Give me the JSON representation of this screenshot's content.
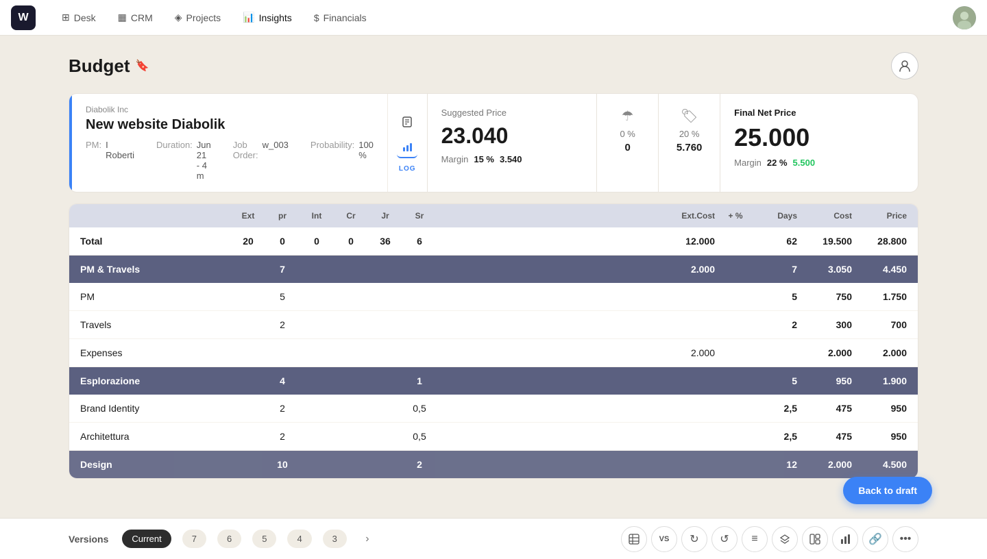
{
  "nav": {
    "logo": "W",
    "items": [
      {
        "label": "Desk",
        "icon": "grid"
      },
      {
        "label": "CRM",
        "icon": "crm"
      },
      {
        "label": "Projects",
        "icon": "layers"
      },
      {
        "label": "Insights",
        "icon": "chart",
        "active": true
      },
      {
        "label": "Financials",
        "icon": "dollar"
      }
    ]
  },
  "page": {
    "title": "Budget",
    "person_icon": "👤"
  },
  "project": {
    "company": "Diabolik Inc",
    "name": "New website Diabolik",
    "pm_label": "PM:",
    "pm_value": "I Roberti",
    "job_label": "Job Order:",
    "job_value": "w_003",
    "duration_label": "Duration:",
    "duration_value": "Jun 21 - 4 m",
    "probability_label": "Probability:",
    "probability_value": "100 %"
  },
  "pricing": {
    "suggested": {
      "title": "Suggested Price",
      "value": "23.040",
      "margin_label": "Margin",
      "margin_pct": "15 %",
      "margin_val": "3.540"
    },
    "disc1": {
      "pct": "0 %",
      "val": "0"
    },
    "disc2": {
      "pct": "20 %",
      "val": "5.760"
    },
    "final": {
      "title": "Final Net Price",
      "value": "25.000",
      "margin_label": "Margin",
      "margin_pct": "22 %",
      "margin_val": "5.500"
    }
  },
  "table": {
    "headers": [
      "",
      "Ext",
      "pr",
      "Int",
      "Cr",
      "Jr",
      "Sr",
      "Ext.Cost",
      "+ %",
      "Days",
      "Cost",
      "Price"
    ],
    "total": {
      "label": "Total",
      "ext": "20",
      "pr": "0",
      "int": "0",
      "cr": "0",
      "jr": "36",
      "sr": "6",
      "ext_cost": "12.000",
      "plus_pct": "",
      "days": "62",
      "cost": "19.500",
      "price": "28.800"
    },
    "groups": [
      {
        "label": "PM & Travels",
        "ext": "",
        "pr": "7",
        "int": "",
        "cr": "",
        "jr": "",
        "sr": "",
        "ext_cost": "2.000",
        "plus_pct": "",
        "days": "7",
        "cost": "3.050",
        "price": "4.450",
        "rows": [
          {
            "label": "PM",
            "ext": "",
            "pr": "5",
            "int": "",
            "cr": "",
            "jr": "",
            "sr": "",
            "ext_cost": "",
            "plus_pct": "",
            "days": "5",
            "cost": "750",
            "price": "1.750"
          },
          {
            "label": "Travels",
            "ext": "",
            "pr": "2",
            "int": "",
            "cr": "",
            "jr": "",
            "sr": "",
            "ext_cost": "",
            "plus_pct": "",
            "days": "2",
            "cost": "300",
            "price": "700"
          },
          {
            "label": "Expenses",
            "ext": "",
            "pr": "",
            "int": "",
            "cr": "",
            "jr": "",
            "sr": "",
            "ext_cost": "2.000",
            "plus_pct": "",
            "days": "",
            "cost": "2.000",
            "price": "2.000"
          }
        ]
      },
      {
        "label": "Esplorazione",
        "ext": "",
        "pr": "4",
        "int": "",
        "cr": "",
        "jr": "",
        "sr": "1",
        "ext_cost": "",
        "plus_pct": "",
        "days": "5",
        "cost": "950",
        "price": "1.900",
        "rows": [
          {
            "label": "Brand Identity",
            "ext": "",
            "pr": "2",
            "int": "",
            "cr": "",
            "jr": "",
            "sr": "0,5",
            "ext_cost": "",
            "plus_pct": "",
            "days": "2,5",
            "cost": "475",
            "price": "950"
          },
          {
            "label": "Architettura",
            "ext": "",
            "pr": "2",
            "int": "",
            "cr": "",
            "jr": "",
            "sr": "0,5",
            "ext_cost": "",
            "plus_pct": "",
            "days": "2,5",
            "cost": "475",
            "price": "950"
          }
        ]
      },
      {
        "label": "Design",
        "ext": "",
        "pr": "10",
        "int": "",
        "cr": "",
        "jr": "",
        "sr": "2",
        "ext_cost": "",
        "plus_pct": "",
        "days": "12",
        "cost": "2.000",
        "price": "4.500",
        "rows": []
      }
    ]
  },
  "versions": {
    "label": "Versions",
    "items": [
      "Current",
      "7",
      "6",
      "5",
      "4",
      "3"
    ],
    "active": "Current"
  },
  "toolbar_icons": [
    "table",
    "vs",
    "refresh",
    "undo",
    "filter",
    "layers",
    "layout",
    "bar-chart",
    "link",
    "more"
  ],
  "back_to_draft": "Back to draft"
}
